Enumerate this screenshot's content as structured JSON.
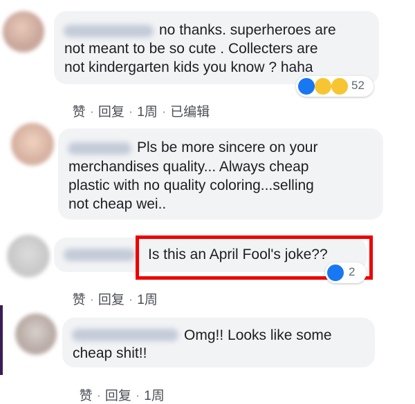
{
  "comments": [
    {
      "text_lines": [
        "no thanks. superheroes are",
        "not meant to be so cute . Collecters are",
        "not kindergarten kids you know ? haha"
      ],
      "actions": {
        "like": "赞",
        "reply": "回复",
        "time": "1周",
        "edited": "已编辑"
      },
      "reactions": {
        "icons": [
          "like-icon",
          "haha-icon",
          "wow-icon"
        ],
        "count": "52"
      }
    },
    {
      "text_lines": [
        "Pls be more sincere on your",
        "merchandises quality... Always cheap",
        "plastic with no quality coloring...selling",
        "not cheap wei.."
      ]
    },
    {
      "text_lines": [
        "Is this an April Fool's joke??"
      ],
      "actions": {
        "like": "赞",
        "reply": "回复",
        "time": "1周"
      },
      "reactions": {
        "icons": [
          "like-icon"
        ],
        "count": "2"
      }
    },
    {
      "text_lines": [
        "Omg!! Looks like some",
        "cheap shit!!"
      ],
      "actions": {
        "like": "赞",
        "reply": "回复",
        "time": "1周"
      }
    }
  ],
  "colors": {
    "highlight": "#ef0000",
    "bubble": "#f2f3f5",
    "like": "#1877f2"
  }
}
